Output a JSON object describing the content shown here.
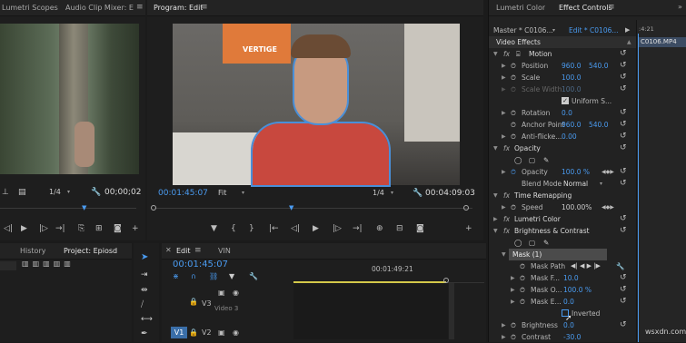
{
  "left_panel": {
    "tabs": [
      "Lumetri Scopes",
      "Audio Clip Mixer: E"
    ],
    "zoom": "1/4",
    "timecode": "00;00;02"
  },
  "program": {
    "title": "Program: Edit",
    "timecode_current": "00:01:45:07",
    "fit": "Fit",
    "zoom": "1/4",
    "timecode_duration": "00:04:09:03",
    "poster_text": "VERTIGE"
  },
  "effect_controls": {
    "tab_lumetri": "Lumetri Color",
    "tab_effect": "Effect Controls",
    "master_clip": "Master * C0106...",
    "edit_clip": "Edit * C0106...",
    "timeline_clip": "C0106.MP4",
    "timeline_time": ":4:21",
    "section": "Video Effects",
    "motion": {
      "name": "Motion",
      "position_label": "Position",
      "position_x": "960.0",
      "position_y": "540.0",
      "scale_label": "Scale",
      "scale": "100.0",
      "scale_width_label": "Scale Width",
      "scale_width": "100.0",
      "uniform_label": "Uniform S...",
      "rotation_label": "Rotation",
      "rotation": "0.0",
      "anchor_label": "Anchor Point",
      "anchor_x": "960.0",
      "anchor_y": "540.0",
      "flicker_label": "Anti-flicke...",
      "flicker": "0.00"
    },
    "opacity": {
      "name": "Opacity",
      "opacity_label": "Opacity",
      "opacity": "100.0 %",
      "blend_label": "Blend Mode",
      "blend": "Normal"
    },
    "time_remap": {
      "name": "Time Remapping",
      "speed_label": "Speed",
      "speed": "100.00%"
    },
    "lumetri": {
      "name": "Lumetri Color"
    },
    "bc": {
      "name": "Brightness & Contrast",
      "mask_name": "Mask (1)",
      "mask_path": "Mask Path",
      "mask_feather_label": "Mask F...",
      "mask_feather": "10.0",
      "mask_opacity_label": "Mask O...",
      "mask_opacity": "100.0 %",
      "mask_expansion_label": "Mask E...",
      "mask_expansion": "0.0",
      "inverted_label": "Inverted",
      "brightness_label": "Brightness",
      "brightness": "0.0",
      "contrast_label": "Contrast",
      "contrast": "-30.0"
    }
  },
  "bottom_left": {
    "tab_history": "History",
    "tab_project": "Project: Epiosd"
  },
  "timeline": {
    "tab_edit": "Edit",
    "tab_vin": "VIN",
    "timecode": "00:01:45:07",
    "ruler_time": "00:01:49:21",
    "track_v3": "V3",
    "track_v3_name": "Video 3",
    "track_v1": "V1",
    "track_v2": "V2"
  },
  "watermark": "wsxdn.com"
}
